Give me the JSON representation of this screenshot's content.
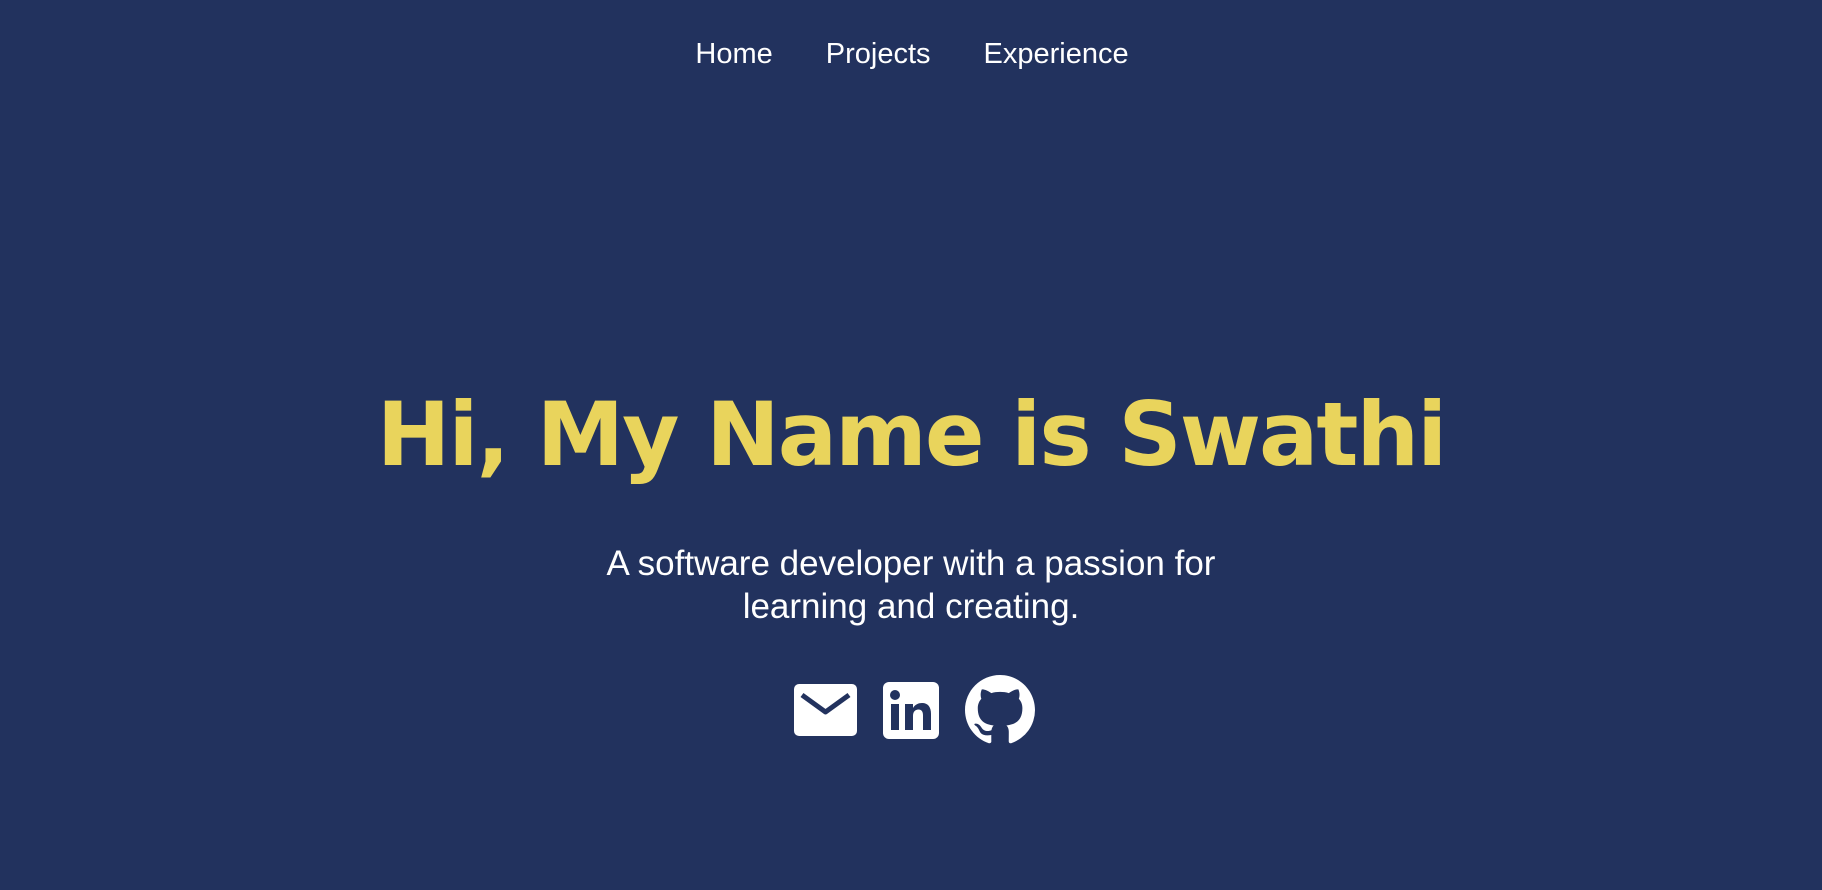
{
  "nav": {
    "items": [
      {
        "label": "Home"
      },
      {
        "label": "Projects"
      },
      {
        "label": "Experience"
      }
    ]
  },
  "hero": {
    "title": "Hi, My Name is Swathi",
    "subtitle": "A software developer with a passion for learning and creating."
  },
  "socials": [
    {
      "icon": "mail-icon"
    },
    {
      "icon": "linkedin-icon"
    },
    {
      "icon": "github-icon"
    }
  ],
  "colors": {
    "background": "#22325e",
    "accent": "#e9d45c",
    "text": "#ffffff"
  }
}
